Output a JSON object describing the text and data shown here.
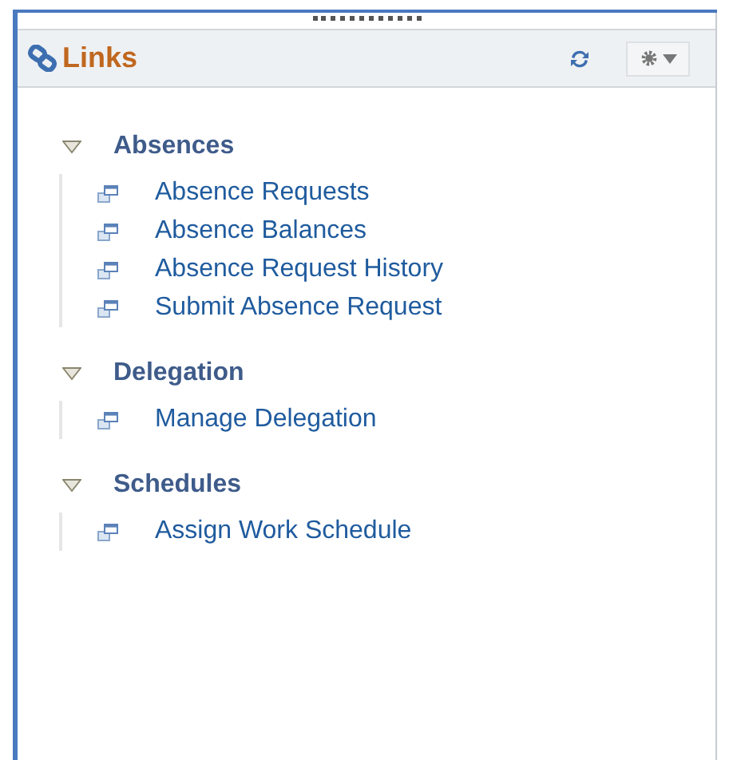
{
  "panel": {
    "title": "Links"
  },
  "groups": [
    {
      "title": "Absences",
      "expanded": true,
      "links": [
        "Absence Requests",
        "Absence Balances",
        "Absence Request History",
        "Submit Absence Request"
      ]
    },
    {
      "title": "Delegation",
      "expanded": true,
      "links": [
        "Manage Delegation"
      ]
    },
    {
      "title": "Schedules",
      "expanded": true,
      "links": [
        "Assign Work Schedule"
      ]
    }
  ]
}
